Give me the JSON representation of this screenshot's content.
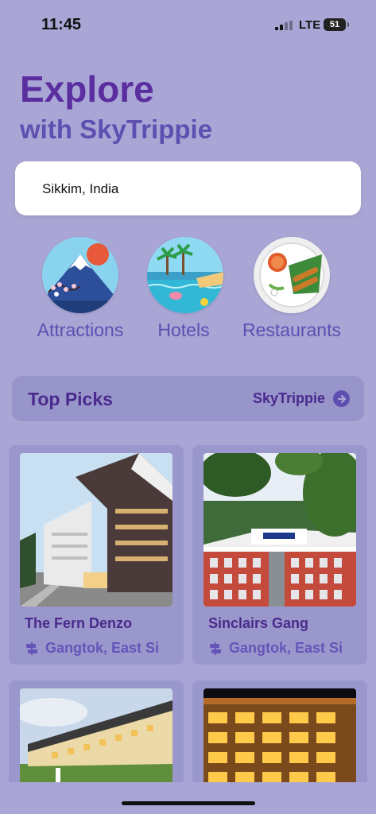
{
  "status": {
    "time": "11:45",
    "network": "LTE",
    "battery": "51"
  },
  "header": {
    "title": "Explore",
    "subtitle": "with SkyTrippie"
  },
  "search": {
    "value": "Sikkim, India"
  },
  "categories": [
    {
      "label": "Attractions",
      "icon": "mountain-icon"
    },
    {
      "label": "Hotels",
      "icon": "pool-icon"
    },
    {
      "label": "Restaurants",
      "icon": "food-plate-icon"
    }
  ],
  "top_picks": {
    "title": "Top Picks",
    "link_label": "SkyTrippie"
  },
  "hotels": [
    {
      "name": "The Fern Denzo",
      "location": "Gangtok, East Si"
    },
    {
      "name": "Sinclairs Gang",
      "location": "Gangtok, East Si"
    },
    {
      "name": "",
      "location": ""
    },
    {
      "name": "",
      "location": ""
    }
  ],
  "colors": {
    "background": "#a9a6d6",
    "title": "#5b2ea0",
    "accent": "#5e4fb0",
    "card": "#9a97cc"
  }
}
